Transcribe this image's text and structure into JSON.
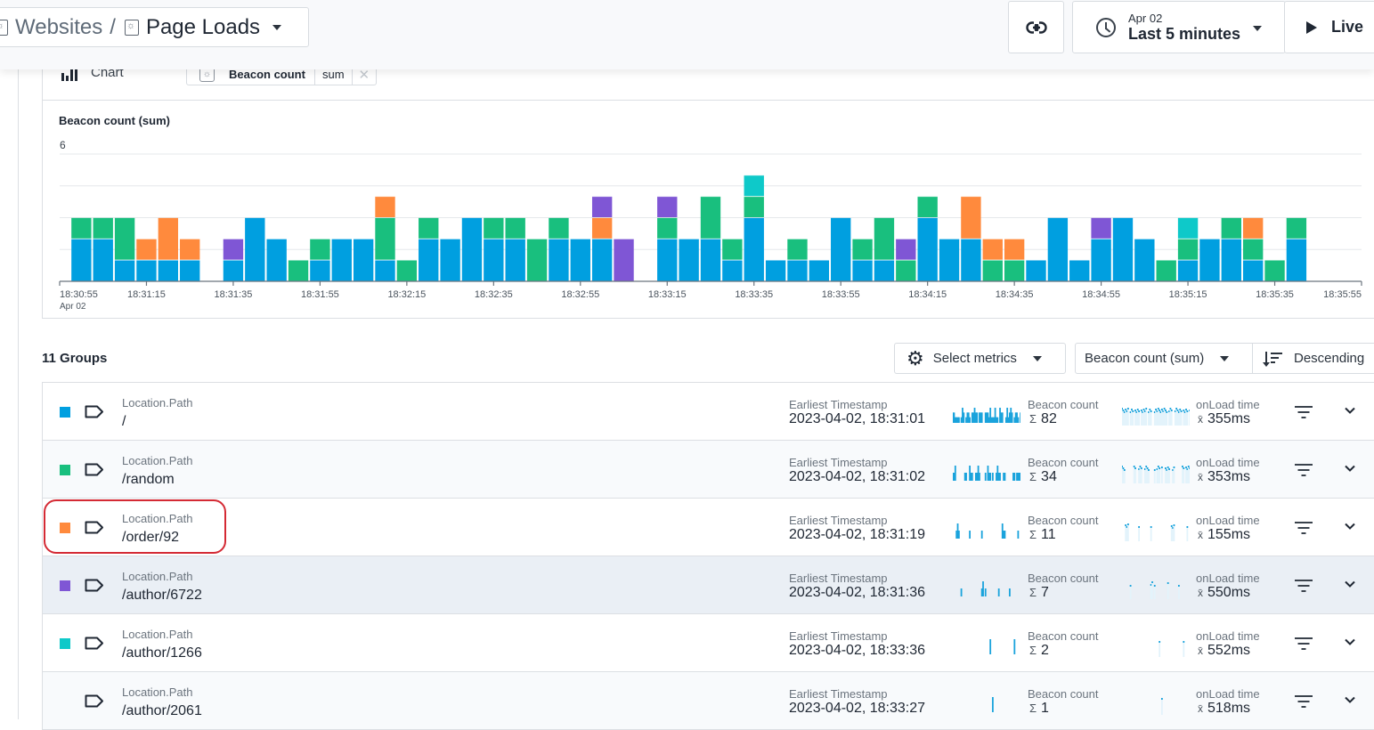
{
  "header": {
    "breadcrumb_parent": "Websites",
    "separator": "/",
    "page_title": "Page Loads",
    "time_range_date": "Apr 02",
    "time_range_label": "Last 5 minutes",
    "live_label": "Live",
    "icons": {
      "link": "link-icon",
      "clock": "clock-icon",
      "play": "play-icon"
    }
  },
  "chart_panel": {
    "type_label": "Chart",
    "metric_name": "Beacon count",
    "metric_aggregation": "sum",
    "remove_glyph": "✕",
    "title": "Beacon count (sum)"
  },
  "chart_data": {
    "type": "bar",
    "stacked": true,
    "title": "Beacon count (sum)",
    "xlabel": "",
    "ylabel": "",
    "ylim": [
      0,
      6
    ],
    "y_tick_labels": [
      "6"
    ],
    "gridlines": [
      1.5,
      3,
      4.5,
      6
    ],
    "x_tick_labels": [
      "18:30:55",
      "18:31:15",
      "18:31:35",
      "18:31:55",
      "18:32:15",
      "18:32:35",
      "18:32:55",
      "18:33:15",
      "18:33:35",
      "18:33:55",
      "18:34:15",
      "18:34:35",
      "18:34:55",
      "18:35:15",
      "18:35:35",
      "18:35:55"
    ],
    "x_sub_label": "Apr 02",
    "x_start": "18:30:55",
    "x_end": "18:35:55",
    "bucket_seconds": 5,
    "categories": [
      "18:31:00",
      "18:31:05",
      "18:31:10",
      "18:31:15",
      "18:31:20",
      "18:31:25",
      "18:31:30",
      "18:31:35",
      "18:31:40",
      "18:31:45",
      "18:31:50",
      "18:31:55",
      "18:32:00",
      "18:32:05",
      "18:32:10",
      "18:32:15",
      "18:32:20",
      "18:32:25",
      "18:32:30",
      "18:32:35",
      "18:32:40",
      "18:32:45",
      "18:32:50",
      "18:32:55",
      "18:33:00",
      "18:33:05",
      "18:33:10",
      "18:33:15",
      "18:33:20",
      "18:33:25",
      "18:33:30",
      "18:33:35",
      "18:33:40",
      "18:33:45",
      "18:33:50",
      "18:33:55",
      "18:34:00",
      "18:34:05",
      "18:34:10",
      "18:34:15",
      "18:34:20",
      "18:34:25",
      "18:34:30",
      "18:34:35",
      "18:34:40",
      "18:34:45",
      "18:34:50",
      "18:34:55",
      "18:35:00",
      "18:35:05",
      "18:35:10",
      "18:35:15",
      "18:35:20",
      "18:35:25",
      "18:35:30",
      "18:35:35",
      "18:35:40"
    ],
    "series": [
      {
        "name": "/",
        "color": "#009fe0",
        "values": [
          2,
          2,
          1,
          1,
          1,
          1,
          0,
          1,
          3,
          2,
          0,
          1,
          2,
          2,
          1,
          0,
          2,
          2,
          3,
          2,
          2,
          0,
          2,
          2,
          2,
          0,
          0,
          2,
          2,
          2,
          1,
          3,
          1,
          1,
          1,
          3,
          1,
          1,
          0,
          3,
          2,
          2,
          0,
          0,
          1,
          3,
          1,
          2,
          3,
          2,
          0,
          1,
          2,
          2,
          1,
          0,
          2
        ]
      },
      {
        "name": "/random",
        "color": "#19bf7e",
        "values": [
          1,
          1,
          2,
          0,
          0,
          0,
          0,
          0,
          0,
          0,
          1,
          1,
          0,
          0,
          2,
          1,
          1,
          0,
          0,
          1,
          1,
          2,
          1,
          0,
          0,
          0,
          0,
          1,
          0,
          2,
          1,
          1,
          0,
          1,
          0,
          0,
          1,
          2,
          1,
          1,
          0,
          0,
          1,
          1,
          0,
          0,
          0,
          0,
          0,
          0,
          1,
          1,
          0,
          1,
          1,
          1,
          1
        ]
      },
      {
        "name": "/order/92",
        "color": "#ff8a3d",
        "values": [
          0,
          0,
          0,
          1,
          2,
          1,
          0,
          0,
          0,
          0,
          0,
          0,
          0,
          0,
          1,
          0,
          0,
          0,
          0,
          0,
          0,
          0,
          0,
          0,
          1,
          0,
          0,
          0,
          0,
          0,
          0,
          0,
          0,
          0,
          0,
          0,
          0,
          0,
          0,
          0,
          0,
          2,
          1,
          1,
          0,
          0,
          0,
          0,
          0,
          0,
          0,
          0,
          0,
          0,
          1,
          0,
          0
        ]
      },
      {
        "name": "/author/6722",
        "color": "#7f56d5",
        "values": [
          0,
          0,
          0,
          0,
          0,
          0,
          0,
          1,
          0,
          0,
          0,
          0,
          0,
          0,
          0,
          0,
          0,
          0,
          0,
          0,
          0,
          0,
          0,
          0,
          1,
          2,
          0,
          1,
          0,
          0,
          0,
          0,
          0,
          0,
          0,
          0,
          0,
          0,
          1,
          0,
          0,
          0,
          0,
          0,
          0,
          0,
          0,
          1,
          0,
          0,
          0,
          0,
          0,
          0,
          0,
          0,
          0
        ]
      },
      {
        "name": "/author/1266",
        "color": "#0ec9c9",
        "values": [
          0,
          0,
          0,
          0,
          0,
          0,
          0,
          0,
          0,
          0,
          0,
          0,
          0,
          0,
          0,
          0,
          0,
          0,
          0,
          0,
          0,
          0,
          0,
          0,
          0,
          0,
          0,
          0,
          0,
          0,
          0,
          1,
          0,
          0,
          0,
          0,
          0,
          0,
          0,
          0,
          0,
          0,
          0,
          0,
          0,
          0,
          0,
          0,
          0,
          0,
          0,
          1,
          0,
          0,
          0,
          0,
          0
        ]
      }
    ]
  },
  "groups": {
    "count_label": "11 Groups",
    "select_metrics_label": "Select metrics",
    "sort_field_label": "Beacon count (sum)",
    "sort_direction_label": "Descending",
    "rows": [
      {
        "type": "Location.Path",
        "value": "/",
        "color": "#009fe0",
        "ts_label": "Earliest Timestamp",
        "ts": "2023-04-02, 18:31:01",
        "bc_label": "Beacon count",
        "bc_sym": "Σ",
        "bc": "82",
        "ol_label": "onLoad time",
        "ol_sym": "x̄",
        "ol": "355ms"
      },
      {
        "type": "Location.Path",
        "value": "/random",
        "color": "#19bf7e",
        "ts_label": "Earliest Timestamp",
        "ts": "2023-04-02, 18:31:02",
        "bc_label": "Beacon count",
        "bc_sym": "Σ",
        "bc": "34",
        "ol_label": "onLoad time",
        "ol_sym": "x̄",
        "ol": "353ms"
      },
      {
        "type": "Location.Path",
        "value": "/order/92",
        "color": "#ff8a3d",
        "ts_label": "Earliest Timestamp",
        "ts": "2023-04-02, 18:31:19",
        "bc_label": "Beacon count",
        "bc_sym": "Σ",
        "bc": "11",
        "ol_label": "onLoad time",
        "ol_sym": "x̄",
        "ol": "155ms"
      },
      {
        "type": "Location.Path",
        "value": "/author/6722",
        "color": "#7f56d5",
        "ts_label": "Earliest Timestamp",
        "ts": "2023-04-02, 18:31:36",
        "bc_label": "Beacon count",
        "bc_sym": "Σ",
        "bc": "7",
        "ol_label": "onLoad time",
        "ol_sym": "x̄",
        "ol": "550ms"
      },
      {
        "type": "Location.Path",
        "value": "/author/1266",
        "color": "#0ec9c9",
        "ts_label": "Earliest Timestamp",
        "ts": "2023-04-02, 18:33:36",
        "bc_label": "Beacon count",
        "bc_sym": "Σ",
        "bc": "2",
        "ol_label": "onLoad time",
        "ol_sym": "x̄",
        "ol": "552ms"
      },
      {
        "type": "Location.Path",
        "value": "/author/2061",
        "color": "",
        "ts_label": "Earliest Timestamp",
        "ts": "2023-04-02, 18:33:27",
        "bc_label": "Beacon count",
        "bc_sym": "Σ",
        "bc": "1",
        "ol_label": "onLoad time",
        "ol_sym": "x̄",
        "ol": "518ms"
      }
    ]
  }
}
